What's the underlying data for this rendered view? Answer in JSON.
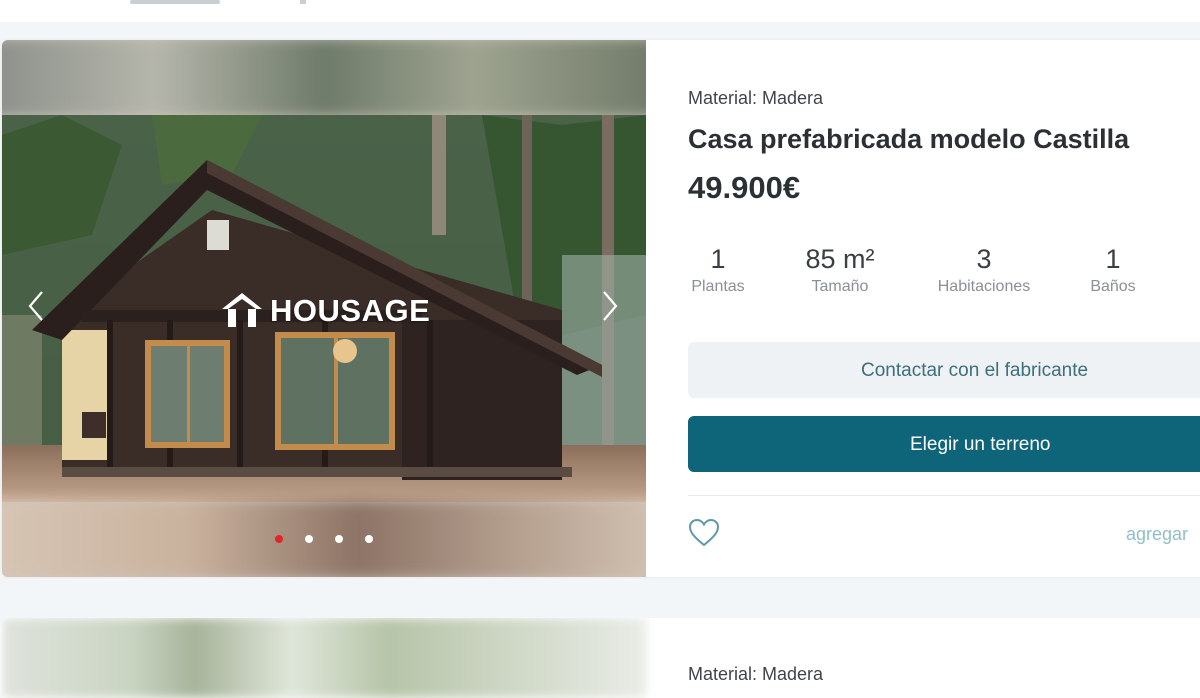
{
  "listing": {
    "material": "Material: Madera",
    "title": "Casa prefabricada modelo Castilla",
    "price": "49.900€",
    "stats": [
      {
        "value": "1",
        "label": "Plantas"
      },
      {
        "value": "85 m²",
        "label": "Tamaño"
      },
      {
        "value": "3",
        "label": "Habitaciones"
      },
      {
        "value": "1",
        "label": "Baños"
      }
    ],
    "contact_button": "Contactar con el fabricante",
    "terrain_button": "Elegir un terreno",
    "add_link": "agregar",
    "gallery": {
      "watermark": "HOUSAGE",
      "slide_count": 4,
      "active_slide": 1,
      "icons": [
        "chevron-left-icon",
        "chevron-right-icon",
        "heart-icon"
      ]
    }
  },
  "next_listing": {
    "material": "Material: Madera"
  },
  "colors": {
    "primary": "#0e6478",
    "secondary_bg": "#eef2f5",
    "active_dot": "#e0262b",
    "link": "#8fbfcb"
  }
}
